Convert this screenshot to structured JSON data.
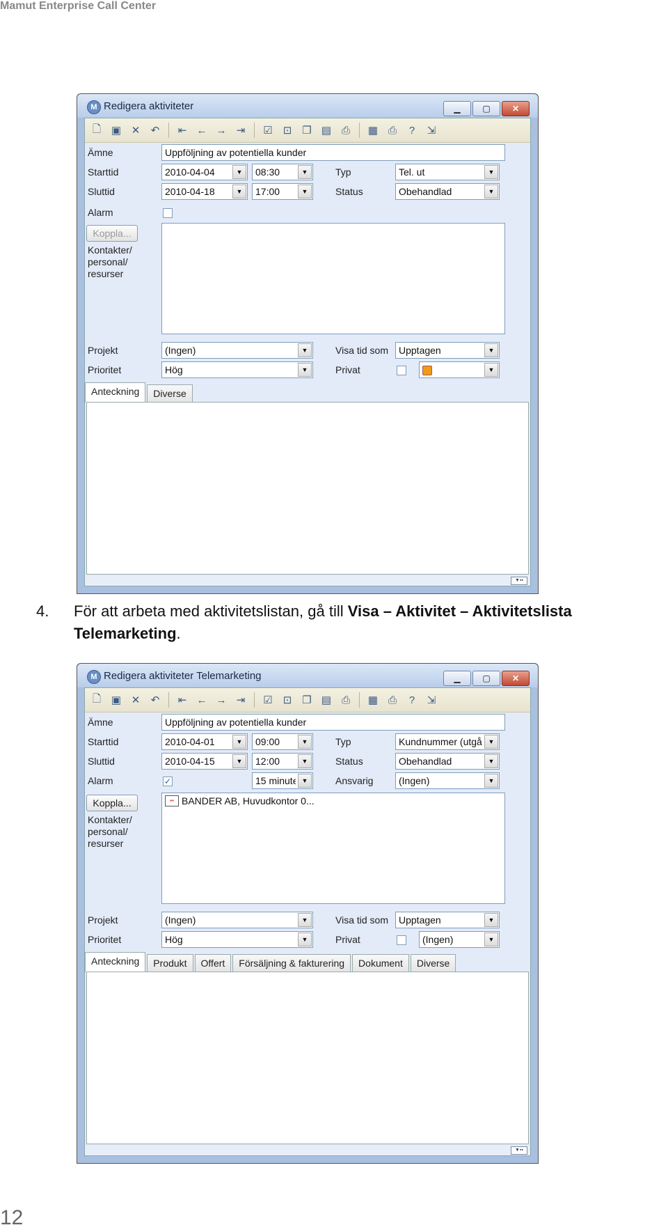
{
  "page": {
    "header": "Mamut Enterprise Call Center",
    "page_number": "12",
    "step": {
      "number": "4.",
      "text_before": "För att arbeta med aktivitetslistan, gå till ",
      "bold_path": "Visa – Aktivitet – Aktivitetslista Telemarketing",
      "text_after": "."
    }
  },
  "toolbar_icons": [
    "new-icon",
    "save-icon",
    "delete-icon",
    "undo-icon",
    "first-icon",
    "previous-icon",
    "next-icon",
    "last-icon",
    "check-icon",
    "preview-icon",
    "copy-icon",
    "folder-icon",
    "print-preview-icon",
    "properties-icon",
    "print-icon",
    "help-icon",
    "exit-icon"
  ],
  "window1": {
    "title": "Redigera aktiviteter",
    "labels": {
      "subject": "Ämne",
      "start": "Starttid",
      "end": "Sluttid",
      "alarm": "Alarm",
      "type": "Typ",
      "status": "Status",
      "contacts": "Kontakter/ personal/ resurser",
      "project": "Projekt",
      "priority": "Prioritet",
      "show_time": "Visa tid som",
      "private": "Privat"
    },
    "subject": "Uppföljning av potentiella kunder",
    "start_date": "2010-04-04",
    "start_time": "08:30",
    "end_date": "2010-04-18",
    "end_time": "17:00",
    "type": "Tel. ut",
    "status": "Obehandlad",
    "alarm_checked": false,
    "connect_button": "Koppla...",
    "project": "(Ingen)",
    "priority": "Hög",
    "show_time_as": "Upptagen",
    "private_checked": false,
    "category_color": "#f09a1a",
    "tabs": [
      "Anteckning",
      "Diverse"
    ]
  },
  "window2": {
    "title": "Redigera aktiviteter Telemarketing",
    "labels": {
      "subject": "Ämne",
      "start": "Starttid",
      "end": "Sluttid",
      "alarm": "Alarm",
      "type": "Typ",
      "status": "Status",
      "responsible": "Ansvarig",
      "contacts": "Kontakter/ personal/ resurser",
      "project": "Projekt",
      "priority": "Prioritet",
      "show_time": "Visa tid som",
      "private": "Privat"
    },
    "subject": "Uppföljning av potentiella kunder",
    "start_date": "2010-04-01",
    "start_time": "09:00",
    "end_date": "2010-04-15",
    "end_time": "12:00",
    "type": "Kundnummer (utgåe",
    "status": "Obehandlad",
    "alarm_checked": true,
    "alarm_time": "15 minute",
    "responsible": "(Ingen)",
    "connect_button": "Koppla...",
    "contact_entry": "BANDER AB, Huvudkontor 0...",
    "project": "(Ingen)",
    "priority": "Hög",
    "show_time_as": "Upptagen",
    "private_checked": false,
    "category": "(Ingen)",
    "tabs": [
      "Anteckning",
      "Produkt",
      "Offert",
      "Försäljning & fakturering",
      "Dokument",
      "Diverse"
    ]
  }
}
